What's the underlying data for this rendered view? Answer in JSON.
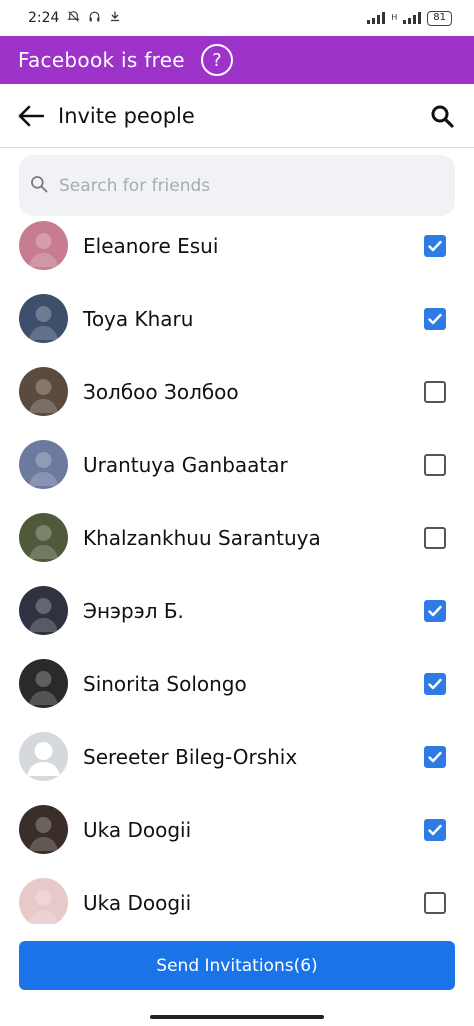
{
  "status": {
    "time": "2:24",
    "battery": "81",
    "network_label": "H"
  },
  "promo": {
    "text": "Facebook is free",
    "help_icon": "?"
  },
  "header": {
    "title": "Invite people"
  },
  "search": {
    "placeholder": "Search for friends"
  },
  "friends": [
    {
      "name": "Eleanore Esui",
      "checked": true,
      "avatar_color": "#c77d8f"
    },
    {
      "name": "Toya Kharu",
      "checked": true,
      "avatar_color": "#3d4f6b"
    },
    {
      "name": "Золбоо Золбоо",
      "checked": false,
      "avatar_color": "#5b4a3e"
    },
    {
      "name": "Urantuya Ganbaatar",
      "checked": false,
      "avatar_color": "#6c7aa0"
    },
    {
      "name": "Khalzankhuu Sarantuya",
      "checked": false,
      "avatar_color": "#4f5a3a"
    },
    {
      "name": "Энэрэл Б.",
      "checked": true,
      "avatar_color": "#2f3240"
    },
    {
      "name": "Sinorita Solongo",
      "checked": true,
      "avatar_color": "#2a2a2a"
    },
    {
      "name": "Sereeter Bileg-Orshix",
      "checked": true,
      "avatar_color": "#d5d8dd"
    },
    {
      "name": "Uka Doogii",
      "checked": true,
      "avatar_color": "#3a2e2a"
    },
    {
      "name": "Uka Doogii",
      "checked": false,
      "avatar_color": "#e7c9c9"
    }
  ],
  "footer": {
    "send_label": "Send Invitations(6)"
  },
  "colors": {
    "promo_bg": "#9d33c8",
    "accent": "#1a73e8",
    "checkbox_checked": "#2e7be5"
  }
}
